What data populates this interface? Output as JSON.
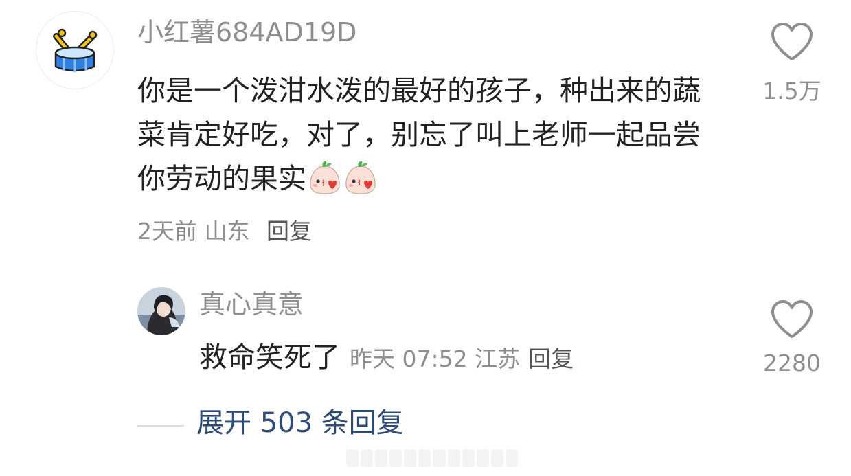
{
  "main_comment": {
    "username": "小红薯684AD19D",
    "text": "你是一个泼泔水泼的最好的孩子，种出来的蔬菜肯定好吃，对了，别忘了叫上老师一起品尝你劳动的果实",
    "emoji_icons": [
      "kiss-peach-emoji",
      "kiss-peach-emoji"
    ],
    "time": "2天前",
    "location": "山东",
    "reply_label": "回复",
    "like_count": "1.5万"
  },
  "reply_comment": {
    "username": "真心真意",
    "text": "救命笑死了",
    "time": "昨天 07:52",
    "location": "江苏",
    "reply_label": "回复",
    "like_count": "2280"
  },
  "expand": {
    "label": "展开 503 条回复"
  },
  "colors": {
    "text_primary": "#222222",
    "text_secondary": "#8e8e8e",
    "expand_link": "#2c4a7a",
    "drum_blue": "#2f7fe0",
    "drum_stick_yellow": "#f5c518"
  }
}
